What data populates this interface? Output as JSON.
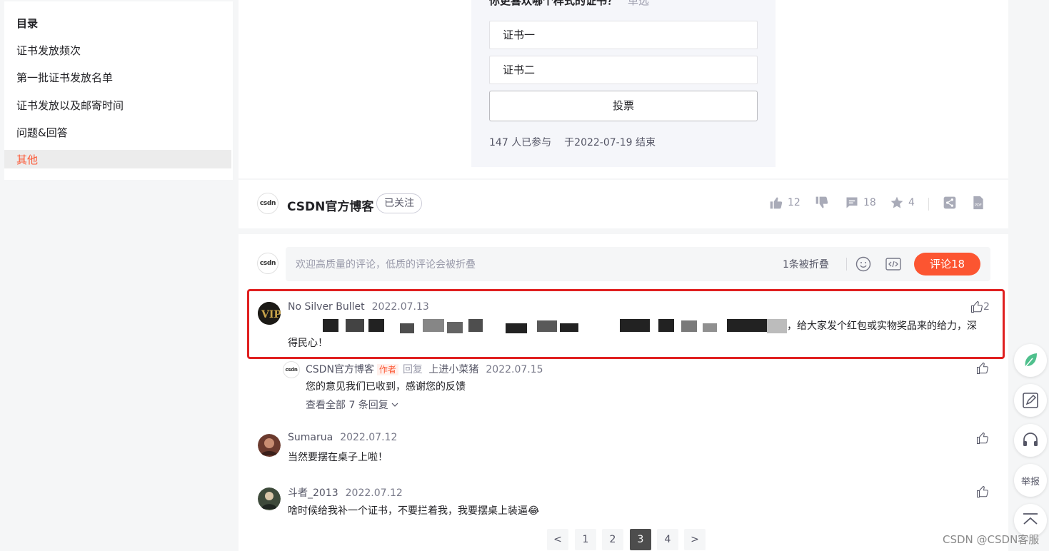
{
  "toc": {
    "items": [
      {
        "label": "目录"
      },
      {
        "label": "证书发放频次"
      },
      {
        "label": "第一批证书发放名单"
      },
      {
        "label": "证书发放以及邮寄时间"
      },
      {
        "label": "问题&回答"
      },
      {
        "label": "其他"
      }
    ]
  },
  "vote": {
    "question": "你更喜欢哪个样式的证书？",
    "type": "单选",
    "options": [
      "证书一",
      "证书二"
    ],
    "submit_label": "投票",
    "participants": "147 人已参与",
    "deadline": "于2022-07-19 结束"
  },
  "author": {
    "logo": "csdn",
    "name": "CSDN官方博客",
    "follow_label": "已关注",
    "likes": "12",
    "comments": "18",
    "favorites": "4"
  },
  "comment_box": {
    "placeholder": "欢迎高质量的评论，低质的评论会被折叠",
    "folded": "1条被折叠",
    "submit_label": "评论18"
  },
  "comments": [
    {
      "user": "No Silver Bullet",
      "date": "2022.07.13",
      "text_visible": "，给大家发个红包或实物奖品来的给力，深",
      "text_line2": "得民心！",
      "likes": "2"
    },
    {
      "user": "CSDN官方博客",
      "author_tag": "作者",
      "reply_word": "回复",
      "reply_to": "上进小菜猪",
      "date": "2022.07.15",
      "text": "您的意见我们已收到，感谢您的反馈",
      "view_all": "查看全部 7 条回复"
    },
    {
      "user": "Sumarua",
      "date": "2022.07.12",
      "text": "当然要摆在桌子上啦！"
    },
    {
      "user": "斗者_2013",
      "date": "2022.07.12",
      "text": "啥时候给我补一个证书，不要拦着我，我要摆桌上装逼😂"
    }
  ],
  "pager": {
    "prev": "<",
    "pages": [
      "1",
      "2",
      "3",
      "4"
    ],
    "next": ">",
    "current": "3"
  },
  "side": {
    "report_label": "举报"
  },
  "watermark": "CSDN @CSDN客服",
  "colors": {
    "accent": "#fc5531",
    "highlight": "#e02020"
  }
}
